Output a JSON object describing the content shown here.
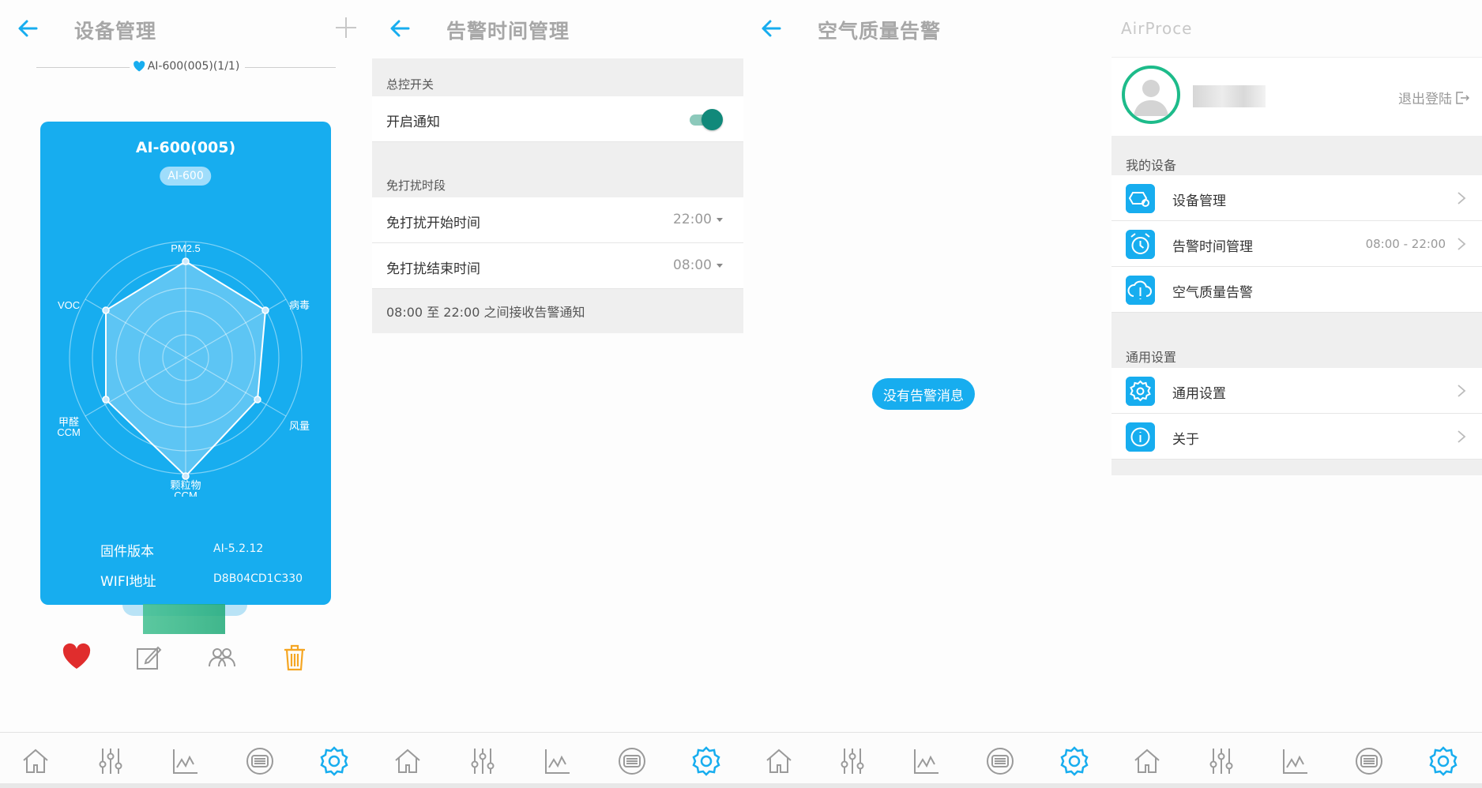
{
  "colors": {
    "accent": "#17adef",
    "toggle_on": "#11897a",
    "avatar_ring": "#1dbb8a",
    "heart": "#e02d2d",
    "trash": "#f5a623"
  },
  "device_screen": {
    "title": "设备管理",
    "pager": "AI-600(005)(1/1)",
    "card": {
      "name": "AI-600(005)",
      "model": "AI-600",
      "radar_labels": {
        "pm25": "PM2.5",
        "virus": "病毒",
        "wind": "风量",
        "particles_1": "颗粒物",
        "particles_2": "CCM",
        "formaldehyde_1": "甲醛",
        "formaldehyde_2": "CCM",
        "voc": "VOC"
      },
      "firmware_label": "固件版本",
      "firmware_value": "AI-5.2.12",
      "wifi_label": "WIFI地址",
      "wifi_value": "D8B04CD1C330"
    },
    "actions": [
      "heart-icon",
      "edit-icon",
      "share-users-icon",
      "trash-icon"
    ]
  },
  "alarm_time_screen": {
    "title": "告警时间管理",
    "master_section": "总控开关",
    "notify_label": "开启通知",
    "notify_on": true,
    "dnd_section": "免打扰时段",
    "dnd_start_label": "免打扰开始时间",
    "dnd_start_value": "22:00",
    "dnd_end_label": "免打扰结束时间",
    "dnd_end_value": "08:00",
    "note": "08:00 至 22:00 之间接收告警通知"
  },
  "air_quality_screen": {
    "title": "空气质量告警",
    "empty": "没有告警消息"
  },
  "settings_screen": {
    "brand": "AirProce",
    "logout": "退出登陆",
    "my_devices_section": "我的设备",
    "items": [
      {
        "label": "设备管理",
        "value": "",
        "icon": "device-gear-icon"
      },
      {
        "label": "告警时间管理",
        "value": "08:00 - 22:00",
        "icon": "alarm-clock-icon"
      },
      {
        "label": "空气质量告警",
        "value": "",
        "icon": "cloud-alert-icon"
      }
    ],
    "general_section": "通用设置",
    "general_items": [
      {
        "label": "通用设置",
        "icon": "settings-gear-icon"
      },
      {
        "label": "关于",
        "icon": "info-icon"
      }
    ]
  },
  "tabbar": [
    "home-icon",
    "sliders-icon",
    "chart-line-icon",
    "filter-icon",
    "settings-icon"
  ],
  "tabbar_active": "settings-icon"
}
